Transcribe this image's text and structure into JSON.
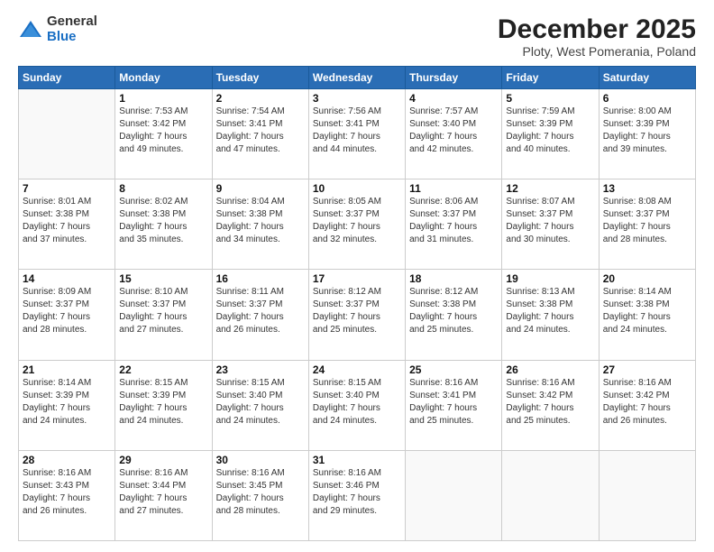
{
  "logo": {
    "general": "General",
    "blue": "Blue"
  },
  "header": {
    "month": "December 2025",
    "location": "Ploty, West Pomerania, Poland"
  },
  "days_of_week": [
    "Sunday",
    "Monday",
    "Tuesday",
    "Wednesday",
    "Thursday",
    "Friday",
    "Saturday"
  ],
  "weeks": [
    [
      {
        "day": "",
        "info": ""
      },
      {
        "day": "1",
        "info": "Sunrise: 7:53 AM\nSunset: 3:42 PM\nDaylight: 7 hours\nand 49 minutes."
      },
      {
        "day": "2",
        "info": "Sunrise: 7:54 AM\nSunset: 3:41 PM\nDaylight: 7 hours\nand 47 minutes."
      },
      {
        "day": "3",
        "info": "Sunrise: 7:56 AM\nSunset: 3:41 PM\nDaylight: 7 hours\nand 44 minutes."
      },
      {
        "day": "4",
        "info": "Sunrise: 7:57 AM\nSunset: 3:40 PM\nDaylight: 7 hours\nand 42 minutes."
      },
      {
        "day": "5",
        "info": "Sunrise: 7:59 AM\nSunset: 3:39 PM\nDaylight: 7 hours\nand 40 minutes."
      },
      {
        "day": "6",
        "info": "Sunrise: 8:00 AM\nSunset: 3:39 PM\nDaylight: 7 hours\nand 39 minutes."
      }
    ],
    [
      {
        "day": "7",
        "info": "Sunrise: 8:01 AM\nSunset: 3:38 PM\nDaylight: 7 hours\nand 37 minutes."
      },
      {
        "day": "8",
        "info": "Sunrise: 8:02 AM\nSunset: 3:38 PM\nDaylight: 7 hours\nand 35 minutes."
      },
      {
        "day": "9",
        "info": "Sunrise: 8:04 AM\nSunset: 3:38 PM\nDaylight: 7 hours\nand 34 minutes."
      },
      {
        "day": "10",
        "info": "Sunrise: 8:05 AM\nSunset: 3:37 PM\nDaylight: 7 hours\nand 32 minutes."
      },
      {
        "day": "11",
        "info": "Sunrise: 8:06 AM\nSunset: 3:37 PM\nDaylight: 7 hours\nand 31 minutes."
      },
      {
        "day": "12",
        "info": "Sunrise: 8:07 AM\nSunset: 3:37 PM\nDaylight: 7 hours\nand 30 minutes."
      },
      {
        "day": "13",
        "info": "Sunrise: 8:08 AM\nSunset: 3:37 PM\nDaylight: 7 hours\nand 28 minutes."
      }
    ],
    [
      {
        "day": "14",
        "info": "Sunrise: 8:09 AM\nSunset: 3:37 PM\nDaylight: 7 hours\nand 28 minutes."
      },
      {
        "day": "15",
        "info": "Sunrise: 8:10 AM\nSunset: 3:37 PM\nDaylight: 7 hours\nand 27 minutes."
      },
      {
        "day": "16",
        "info": "Sunrise: 8:11 AM\nSunset: 3:37 PM\nDaylight: 7 hours\nand 26 minutes."
      },
      {
        "day": "17",
        "info": "Sunrise: 8:12 AM\nSunset: 3:37 PM\nDaylight: 7 hours\nand 25 minutes."
      },
      {
        "day": "18",
        "info": "Sunrise: 8:12 AM\nSunset: 3:38 PM\nDaylight: 7 hours\nand 25 minutes."
      },
      {
        "day": "19",
        "info": "Sunrise: 8:13 AM\nSunset: 3:38 PM\nDaylight: 7 hours\nand 24 minutes."
      },
      {
        "day": "20",
        "info": "Sunrise: 8:14 AM\nSunset: 3:38 PM\nDaylight: 7 hours\nand 24 minutes."
      }
    ],
    [
      {
        "day": "21",
        "info": "Sunrise: 8:14 AM\nSunset: 3:39 PM\nDaylight: 7 hours\nand 24 minutes."
      },
      {
        "day": "22",
        "info": "Sunrise: 8:15 AM\nSunset: 3:39 PM\nDaylight: 7 hours\nand 24 minutes."
      },
      {
        "day": "23",
        "info": "Sunrise: 8:15 AM\nSunset: 3:40 PM\nDaylight: 7 hours\nand 24 minutes."
      },
      {
        "day": "24",
        "info": "Sunrise: 8:15 AM\nSunset: 3:40 PM\nDaylight: 7 hours\nand 24 minutes."
      },
      {
        "day": "25",
        "info": "Sunrise: 8:16 AM\nSunset: 3:41 PM\nDaylight: 7 hours\nand 25 minutes."
      },
      {
        "day": "26",
        "info": "Sunrise: 8:16 AM\nSunset: 3:42 PM\nDaylight: 7 hours\nand 25 minutes."
      },
      {
        "day": "27",
        "info": "Sunrise: 8:16 AM\nSunset: 3:42 PM\nDaylight: 7 hours\nand 26 minutes."
      }
    ],
    [
      {
        "day": "28",
        "info": "Sunrise: 8:16 AM\nSunset: 3:43 PM\nDaylight: 7 hours\nand 26 minutes."
      },
      {
        "day": "29",
        "info": "Sunrise: 8:16 AM\nSunset: 3:44 PM\nDaylight: 7 hours\nand 27 minutes."
      },
      {
        "day": "30",
        "info": "Sunrise: 8:16 AM\nSunset: 3:45 PM\nDaylight: 7 hours\nand 28 minutes."
      },
      {
        "day": "31",
        "info": "Sunrise: 8:16 AM\nSunset: 3:46 PM\nDaylight: 7 hours\nand 29 minutes."
      },
      {
        "day": "",
        "info": ""
      },
      {
        "day": "",
        "info": ""
      },
      {
        "day": "",
        "info": ""
      }
    ]
  ]
}
